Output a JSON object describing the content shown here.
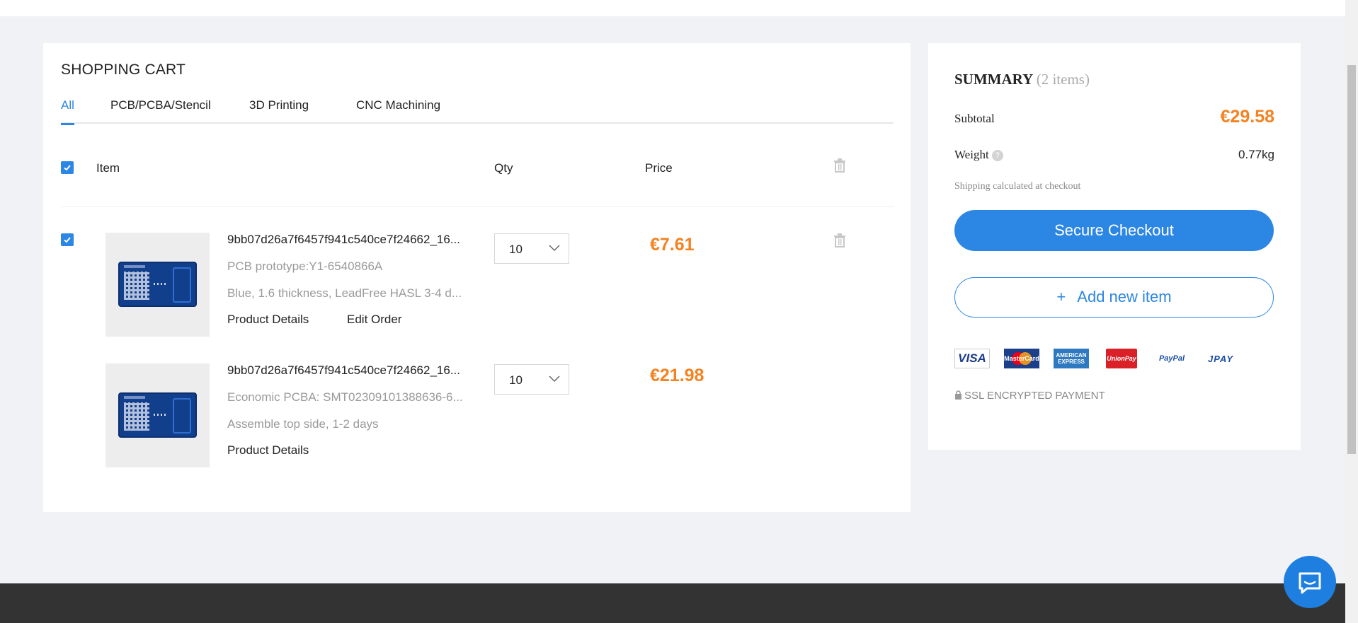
{
  "cart": {
    "title": "SHOPPING CART",
    "tabs": [
      {
        "label": "All",
        "active": true
      },
      {
        "label": "PCB/PCBA/Stencil",
        "active": false
      },
      {
        "label": "3D Printing",
        "active": false
      },
      {
        "label": "CNC Machining",
        "active": false
      }
    ],
    "columns": {
      "item": "Item",
      "qty": "Qty",
      "price": "Price"
    },
    "items": [
      {
        "checked": true,
        "name": "9bb07d26a7f6457f941c540ce7f24662_16...",
        "type": "PCB prototype:Y1-6540866A",
        "spec": "Blue, 1.6 thickness, LeadFree HASL 3-4 d...",
        "qty": "10",
        "price": "€7.61",
        "links": {
          "details": "Product Details",
          "edit": "Edit Order"
        }
      },
      {
        "checked": false,
        "name": "9bb07d26a7f6457f941c540ce7f24662_16...",
        "type": "Economic PCBA: SMT02309101388636-6...",
        "spec": "Assemble top side, 1-2 days",
        "qty": "10",
        "price": "€21.98",
        "links": {
          "details": "Product Details"
        }
      }
    ]
  },
  "summary": {
    "title": "SUMMARY",
    "count": "(2 items)",
    "subtotal_label": "Subtotal",
    "subtotal_value": "€29.58",
    "weight_label": "Weight",
    "weight_value": "0.77kg",
    "help_glyph": "?",
    "shipping_note": "Shipping calculated at checkout",
    "checkout_label": "Secure Checkout",
    "add_plus": "+",
    "add_label": "Add new item",
    "payment_methods": {
      "visa": "VISA",
      "mastercard": "MasterCard",
      "amex_1": "AMERICAN",
      "amex_2": "EXPRESS",
      "unionpay": "UnionPay",
      "paypal": "PayPal",
      "jpay": "JPAY"
    },
    "ssl_label": "SSL ENCRYPTED PAYMENT"
  },
  "colors": {
    "accent": "#2c86e4",
    "price": "#f58220",
    "footer": "#333333"
  },
  "icons": [
    "check-icon",
    "trash-icon",
    "chevron-down-icon",
    "help-icon",
    "lock-icon",
    "chat-icon"
  ]
}
